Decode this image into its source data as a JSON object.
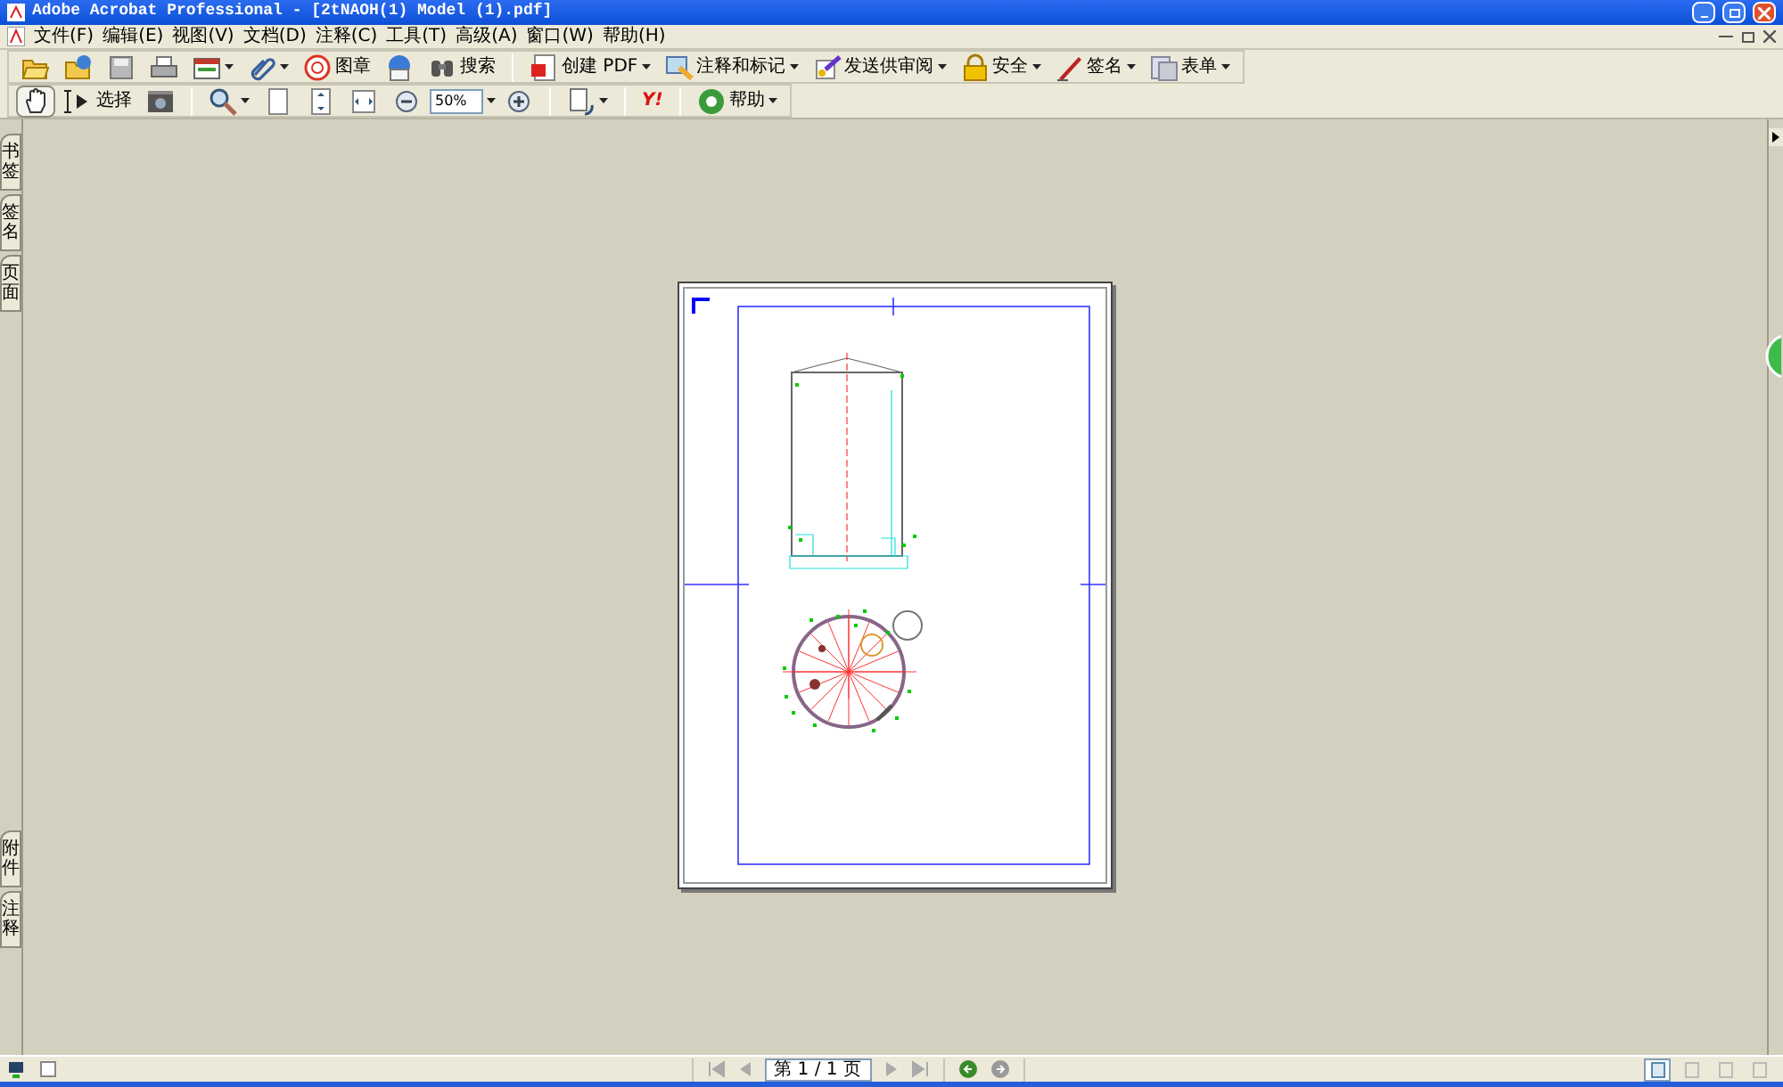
{
  "window": {
    "title": "Adobe Acrobat Professional - [2tNAOH(1) Model (1).pdf]"
  },
  "menu": [
    "文件(F)",
    "编辑(E)",
    "视图(V)",
    "文档(D)",
    "注释(C)",
    "工具(T)",
    "高级(A)",
    "窗口(W)",
    "帮助(H)"
  ],
  "toolbar_1": [
    {
      "kind": "open",
      "dropdown": false
    },
    {
      "kind": "organizer",
      "dropdown": false
    },
    {
      "kind": "save",
      "dropdown": false
    },
    {
      "kind": "print",
      "dropdown": false
    },
    {
      "kind": "tasks",
      "dropdown": true
    },
    {
      "kind": "attach",
      "dropdown": true
    },
    {
      "kind": "stamp",
      "label": "图章",
      "dropdown": false
    },
    {
      "kind": "email",
      "dropdown": false
    },
    {
      "kind": "search",
      "label": "搜索",
      "dropdown": false
    },
    {
      "kind": "separator"
    },
    {
      "kind": "create",
      "label": "创建 PDF",
      "dropdown": true
    },
    {
      "kind": "comment",
      "label": "注释和标记",
      "dropdown": true
    },
    {
      "kind": "review",
      "label": "发送供审阅",
      "dropdown": true
    },
    {
      "kind": "secure",
      "label": "安全",
      "dropdown": true
    },
    {
      "kind": "sign",
      "label": "签名",
      "dropdown": true
    },
    {
      "kind": "forms",
      "label": "表单",
      "dropdown": true
    }
  ],
  "toolbar_2": [
    {
      "kind": "hand",
      "dropdown": false,
      "selected": true
    },
    {
      "kind": "select",
      "label": "选择",
      "dropdown": false,
      "selected": false
    },
    {
      "kind": "snapshot",
      "dropdown": false,
      "selected": false
    },
    {
      "kind": "separator"
    },
    {
      "kind": "zoom",
      "dropdown": true,
      "selected": false
    },
    {
      "kind": "actual",
      "dropdown": false,
      "selected": false
    },
    {
      "kind": "fitpage",
      "dropdown": false,
      "selected": false
    },
    {
      "kind": "fitwidth",
      "dropdown": false,
      "selected": false
    },
    {
      "kind": "zoomout",
      "dropdown": false,
      "selected": false
    },
    {
      "kind": "zoomfield",
      "value": "50%"
    },
    {
      "kind": "zoomin",
      "dropdown": false,
      "selected": false
    },
    {
      "kind": "separator"
    },
    {
      "kind": "rotate",
      "dropdown": true,
      "selected": false
    },
    {
      "kind": "separator"
    },
    {
      "kind": "yahoo",
      "label": "Y!",
      "dropdown": false,
      "selected": false
    },
    {
      "kind": "separator"
    },
    {
      "kind": "help",
      "label": "帮助",
      "dropdown": true,
      "selected": false
    }
  ],
  "side_tabs": {
    "top": [
      "书签",
      "签名",
      "页面"
    ],
    "bottom": [
      "附件",
      "注释"
    ]
  },
  "status_bar": {
    "page_field": "第 1 / 1 页",
    "layouts": [
      {
        "selected": true
      },
      {
        "selected": false
      },
      {
        "selected": false
      },
      {
        "selected": false
      }
    ]
  }
}
